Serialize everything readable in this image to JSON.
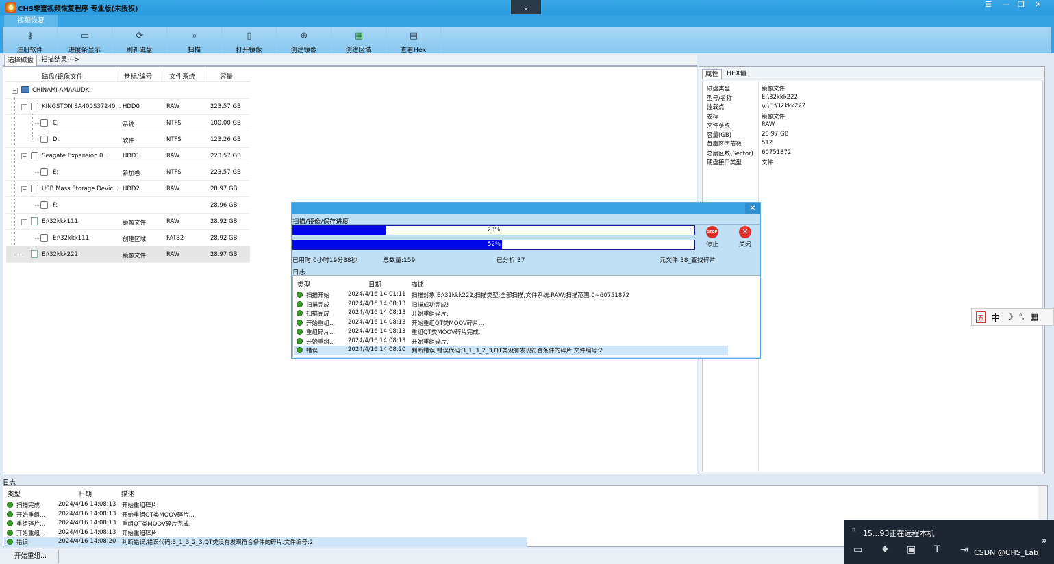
{
  "window": {
    "title": "CHS零壹视频恢复程序 专业版(未授权)",
    "controls": [
      "☰",
      "—",
      "❐",
      "✕"
    ],
    "collapse_glyph": "⌄"
  },
  "ribbon": {
    "tab": "视频恢复",
    "buttons": [
      {
        "label": "注册软件",
        "icon": "key-icon"
      },
      {
        "label": "进度条显示",
        "icon": "progress-icon"
      },
      {
        "label": "刷新磁盘",
        "icon": "disk-refresh-icon"
      },
      {
        "label": "扫描",
        "icon": "scan-icon"
      },
      {
        "label": "打开镜像",
        "icon": "open-image-icon"
      },
      {
        "label": "创建镜像",
        "icon": "create-image-icon"
      },
      {
        "label": "创建区域",
        "icon": "create-region-icon"
      },
      {
        "label": "查看Hex",
        "icon": "hex-icon"
      }
    ]
  },
  "tabs": [
    "选择磁盘",
    "扫描结果--->"
  ],
  "tree": {
    "headers": [
      "磁盘/镜像文件",
      "卷标/编号",
      "文件系统",
      "容量"
    ],
    "root": "CHINAMI-AMAAUDK",
    "rows": [
      {
        "name": "KINGSTON SA400S37240...",
        "id": "HDD0",
        "fs": "RAW",
        "size": "223.57 GB"
      },
      {
        "name": "C:",
        "id": "系统",
        "fs": "NTFS",
        "size": "100.00 GB"
      },
      {
        "name": "D:",
        "id": "软件",
        "fs": "NTFS",
        "size": "123.26 GB"
      },
      {
        "name": "Seagate Expansion      0...",
        "id": "HDD1",
        "fs": "RAW",
        "size": "223.57 GB"
      },
      {
        "name": "E:",
        "id": "新加卷",
        "fs": "NTFS",
        "size": "223.57 GB"
      },
      {
        "name": "USB Mass Storage Devic...",
        "id": "HDD2",
        "fs": "RAW",
        "size": "28.97 GB"
      },
      {
        "name": "F:",
        "id": "",
        "fs": "",
        "size": "28.96 GB"
      },
      {
        "name": "E:\\32kkk111",
        "id": "镜像文件",
        "fs": "RAW",
        "size": "28.92 GB"
      },
      {
        "name": "E:\\32kkk111",
        "id": "创建区域",
        "fs": "FAT32",
        "size": "28.92 GB"
      },
      {
        "name": "E:\\32kkk222",
        "id": "镜像文件",
        "fs": "RAW",
        "size": "28.97 GB"
      }
    ]
  },
  "properties": {
    "tabs": [
      "属性",
      "HEX值"
    ],
    "rows": [
      {
        "k": "磁盘类型",
        "v": "镜像文件"
      },
      {
        "k": "型号/名称",
        "v": "E:\\32kkk222"
      },
      {
        "k": "挂载点",
        "v": "\\\\.\\E:\\32kkk222"
      },
      {
        "k": "卷标",
        "v": "镜像文件"
      },
      {
        "k": "文件系统:",
        "v": "RAW"
      },
      {
        "k": "容量(GB)",
        "v": "28.97 GB"
      },
      {
        "k": "每扇区字节数",
        "v": "512"
      },
      {
        "k": "总扇区数(Sector)",
        "v": "60751872"
      },
      {
        "k": "硬盘接口类型",
        "v": "文件"
      }
    ]
  },
  "dialog": {
    "close_glyph": "✕",
    "title": "扫描/镜像/保存进度",
    "progress1": {
      "percent": 23,
      "label": "23%"
    },
    "progress2": {
      "percent": 52,
      "label": "52%"
    },
    "stop_label": "停止",
    "stop_glyph": "STOP",
    "close_label": "关闭",
    "close_btn_glyph": "✕",
    "elapsed": "已用时:0小时19分38秒",
    "total": "总数量:159",
    "analyzed": "已分析:37",
    "meta": "元文件:38_查找碎片",
    "log_title": "日志",
    "log_headers": [
      "类型",
      "日期",
      "描述"
    ],
    "log_rows": [
      {
        "type": "扫描开始",
        "date": "2024/4/16 14:01:11",
        "desc": "扫描对象:E:\\32kkk222;扫描类型:全部扫描;文件系统:RAW;扫描范围:0~60751872"
      },
      {
        "type": "扫描完成",
        "date": "2024/4/16 14:08:13",
        "desc": "扫描成功完成!"
      },
      {
        "type": "扫描完成",
        "date": "2024/4/16 14:08:13",
        "desc": "开始重组碎片."
      },
      {
        "type": "开始重组...",
        "date": "2024/4/16 14:08:13",
        "desc": "开始重组QT类MOOV碎片..."
      },
      {
        "type": "重组碎片...",
        "date": "2024/4/16 14:08:13",
        "desc": "重组QT类MOOV碎片完成."
      },
      {
        "type": "开始重组...",
        "date": "2024/4/16 14:08:13",
        "desc": "开始重组碎片."
      },
      {
        "type": "错误",
        "date": "2024/4/16 14:08:20",
        "desc": "判断错误,错误代码:3_1_3_2_3,QT类没有发现符合条件的碎片.文件编号:2"
      }
    ]
  },
  "bottom_log": {
    "title": "日志",
    "headers": [
      "类型",
      "日期",
      "描述"
    ],
    "rows": [
      {
        "type": "扫描完成",
        "date": "2024/4/16 14:08:13",
        "desc": "开始重组碎片."
      },
      {
        "type": "开始重组...",
        "date": "2024/4/16 14:08:13",
        "desc": "开始重组QT类MOOV碎片..."
      },
      {
        "type": "重组碎片...",
        "date": "2024/4/16 14:08:13",
        "desc": "重组QT类MOOV碎片完成."
      },
      {
        "type": "开始重组...",
        "date": "2024/4/16 14:08:13",
        "desc": "开始重组碎片."
      },
      {
        "type": "错误",
        "date": "2024/4/16 14:08:20",
        "desc": "判断错误,错误代码:3_1_3_2_3,QT类没有发现符合条件的碎片.文件编号:2"
      }
    ]
  },
  "status": "开始重组...",
  "ime": [
    "五",
    "中",
    "☽",
    "°,",
    "▦"
  ],
  "remote": {
    "text": "15...93正在远程本机",
    "icons": [
      "chat-icon",
      "mic-icon",
      "screen-icon",
      "text-icon",
      "exit-icon"
    ],
    "icon_glyphs": [
      "▭",
      "♦",
      "▣",
      "T",
      "⇥"
    ],
    "more_glyph": "»",
    "user_glyph": "ᴿ"
  },
  "watermark": "CSDN @CHS_Lab"
}
